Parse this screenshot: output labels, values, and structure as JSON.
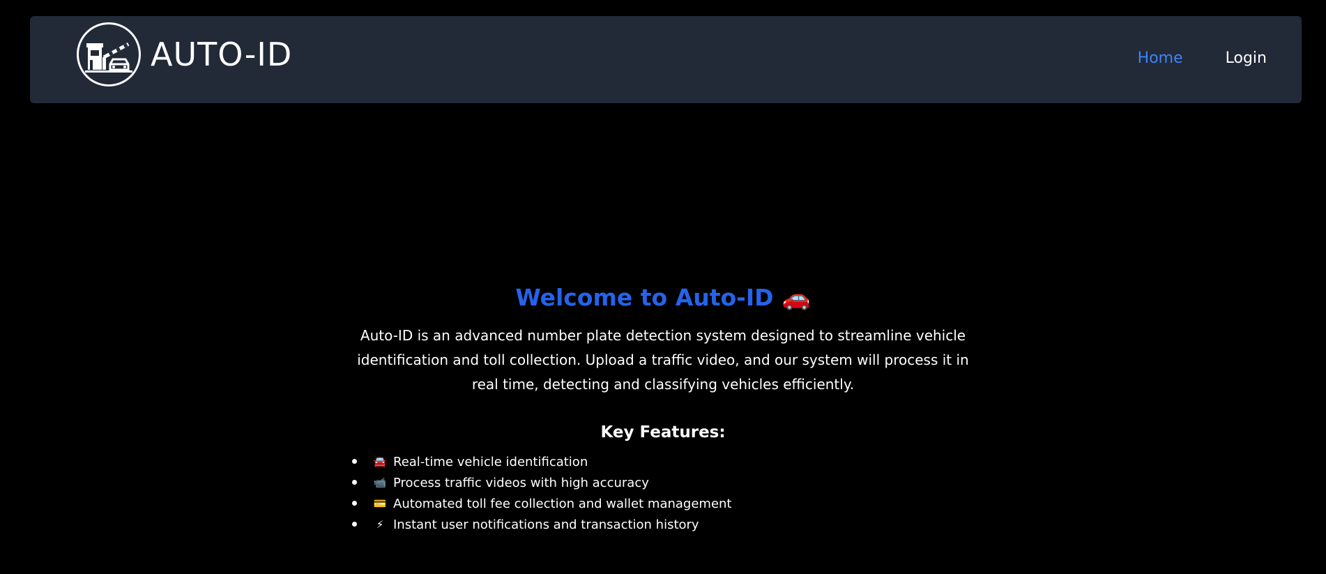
{
  "brand": {
    "name": "AUTO-ID",
    "logo_icon": "toll-booth-icon"
  },
  "nav": {
    "home_label": "Home",
    "login_label": "Login",
    "active_color": "#3f83f8"
  },
  "hero": {
    "title": "Welcome to Auto-ID",
    "title_emoji": "🚗",
    "title_color": "#2563eb",
    "description": "Auto-ID is an advanced number plate detection system designed to streamline vehicle identification and toll collection. Upload a traffic video, and our system will process it in real time, detecting and classifying vehicles efficiently."
  },
  "features": {
    "title": "Key Features:",
    "items": [
      {
        "icon": "🚘",
        "text": "Real-time vehicle identification"
      },
      {
        "icon": "📹",
        "text": "Process traffic videos with high accuracy"
      },
      {
        "icon": "💳",
        "text": "Automated toll fee collection and wallet management"
      },
      {
        "icon": "⚡",
        "text": "Instant user notifications and transaction history"
      }
    ]
  }
}
